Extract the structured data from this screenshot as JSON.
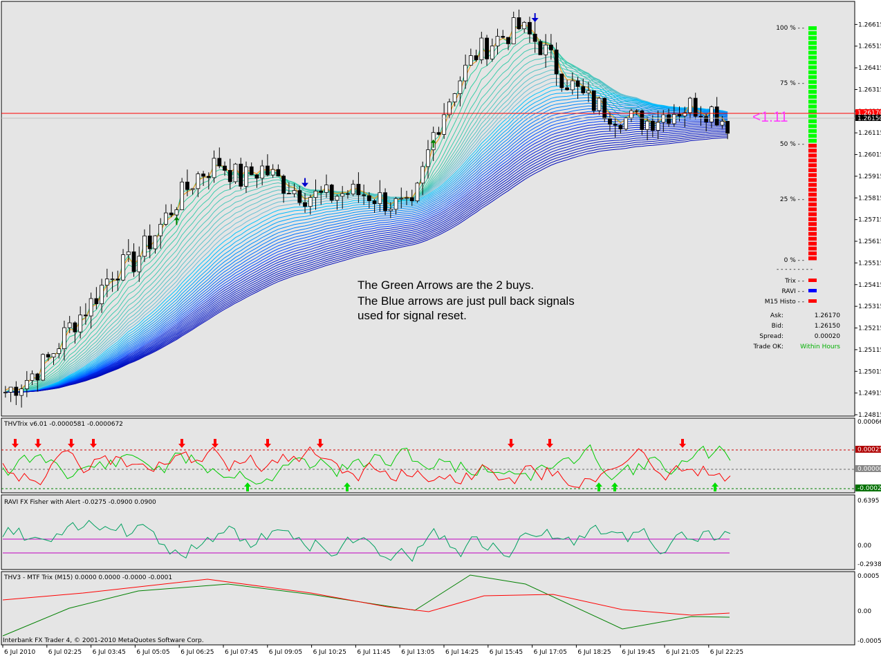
{
  "window": {
    "footer": "Interbank FX Trader 4, © 2001-2010 MetaQuotes Software Corp."
  },
  "colors": {
    "background": "#e5e5e5",
    "grid": "#bdbdbd",
    "bull": "#ffffff",
    "bear": "#000000",
    "price_line": "#ff0000",
    "bid_line": "#c8c8c8",
    "green": "#00c000",
    "red": "#ff0000",
    "blue": "#0000ff",
    "magenta": "#c800c8"
  },
  "price_axis": {
    "ticks": [
      "1.26615",
      "1.26515",
      "1.26415",
      "1.26315",
      "1.26215",
      "1.26115",
      "1.26015",
      "1.25915",
      "1.25815",
      "1.25715",
      "1.25615",
      "1.25515",
      "1.25415",
      "1.25315",
      "1.25215",
      "1.25115",
      "1.25015",
      "1.24915",
      "1.24815"
    ],
    "ask_label": "1.26170",
    "bid_label": "1.26150"
  },
  "time_axis": {
    "ticks": [
      "6 Jul 2010",
      "6 Jul 02:25",
      "6 Jul 03:45",
      "6 Jul 05:05",
      "6 Jul 06:25",
      "6 Jul 07:45",
      "6 Jul 09:05",
      "6 Jul 10:25",
      "6 Jul 11:45",
      "6 Jul 13:05",
      "6 Jul 14:25",
      "6 Jul 15:45",
      "6 Jul 17:05",
      "6 Jul 18:25",
      "6 Jul 19:45",
      "6 Jul 21:05",
      "6 Jul 22:25"
    ]
  },
  "annotation": {
    "line1": "The Green Arrows are the 2 buys.",
    "line2": "The Blue arrows are just pull back signals",
    "line3": "used for signal reset."
  },
  "ratio_label": "<1.11",
  "gauge": {
    "labels": [
      "100 % - -",
      "75 % - -",
      "50 % - -",
      "25 % - -",
      "0 % - -"
    ],
    "level": 0.5,
    "divider": "- - - - - - - - -"
  },
  "legend": [
    {
      "label": "Trix - -",
      "color": "#ff0000"
    },
    {
      "label": "RAVI - -",
      "color": "#0000ff"
    },
    {
      "label": "M15 Histo - -",
      "color": "#ff0000"
    }
  ],
  "info": [
    {
      "key": "Ask:",
      "value": "1.26170",
      "value_color": "#000000"
    },
    {
      "key": "Bid:",
      "value": "1.26150",
      "value_color": "#000000"
    },
    {
      "key": "Spread:",
      "value": "0.00020",
      "value_color": "#000000"
    },
    {
      "key": "Trade OK:",
      "value": "Within Hours",
      "value_color": "#00b000"
    }
  ],
  "sub1": {
    "title": "THVTrix v6.01 -0.0000581 -0.0000672",
    "ticks": [
      "0.000664",
      "0.00025",
      "0.00000",
      "-0.00025"
    ]
  },
  "sub2": {
    "title": "RAVI FX Fisher with Alert -0.0275 -0.0900 0.0900",
    "ticks": [
      "0.6395",
      "0.00",
      "-0.2938"
    ]
  },
  "sub3": {
    "title": "THV3 - MTF Trix (M15) 0.0000 0.0000 -0.0000 -0.0001",
    "ticks": [
      "0.0005",
      "0.00",
      "-0.0005"
    ]
  },
  "chart_data": {
    "type": "line",
    "price_ylim": [
      1.24815,
      1.26715
    ],
    "price_path": [
      [
        0,
        1.2492
      ],
      [
        4,
        1.2498
      ],
      [
        8,
        1.2507
      ],
      [
        12,
        1.2522
      ],
      [
        16,
        1.2533
      ],
      [
        20,
        1.2548
      ],
      [
        24,
        1.2552
      ],
      [
        28,
        1.2565
      ],
      [
        32,
        1.258
      ],
      [
        36,
        1.2592
      ],
      [
        40,
        1.2598
      ],
      [
        44,
        1.259
      ],
      [
        48,
        1.2595
      ],
      [
        52,
        1.2588
      ],
      [
        56,
        1.2583
      ],
      [
        60,
        1.2582
      ],
      [
        64,
        1.2584
      ],
      [
        68,
        1.2583
      ],
      [
        72,
        1.2579
      ],
      [
        76,
        1.2575
      ],
      [
        80,
        1.2611
      ],
      [
        84,
        1.2633
      ],
      [
        88,
        1.2648
      ],
      [
        92,
        1.2655
      ],
      [
        96,
        1.266
      ],
      [
        100,
        1.2652
      ],
      [
        104,
        1.2638
      ],
      [
        108,
        1.2628
      ],
      [
        112,
        1.2622
      ],
      [
        116,
        1.2618
      ],
      [
        120,
        1.2617
      ],
      [
        124,
        1.2621
      ],
      [
        128,
        1.2624
      ],
      [
        132,
        1.2622
      ],
      [
        135,
        1.2616
      ]
    ],
    "green_arrow_bars": [
      32,
      80
    ],
    "blue_arrow_bars": [
      56,
      99
    ]
  }
}
